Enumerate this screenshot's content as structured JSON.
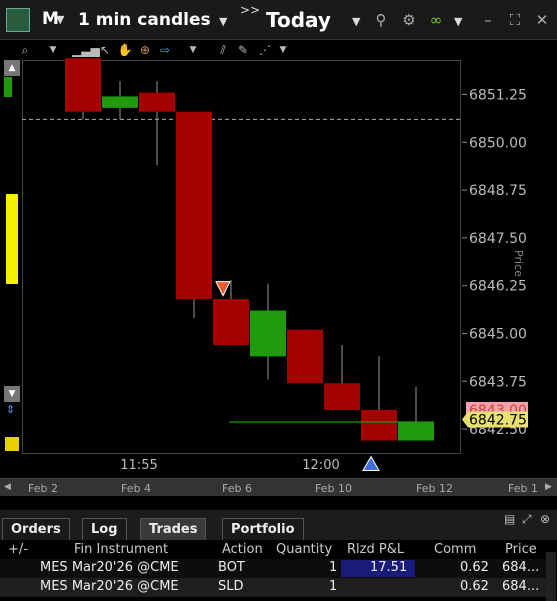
{
  "titlebar": {
    "symbol": "M",
    "period": "1 min candles",
    "range_icon": ">>",
    "range": "Today"
  },
  "chart": {
    "price_ticks": [
      "6851.25",
      "6850.00",
      "6848.75",
      "6847.50",
      "6846.25",
      "6845.00",
      "6843.75",
      "6842.50"
    ],
    "current_price": "6842.75",
    "bid_label": "6843.00",
    "axis_title": "Price",
    "time_labels": [
      "11:55",
      "12:00"
    ],
    "colors": {
      "up": "#1f9a0c",
      "down": "#a50000",
      "up_marker": "#3d6fe0",
      "down_marker": "#e85a2a"
    }
  },
  "chart_data": {
    "type": "candlestick",
    "timeframe": "1 min",
    "ylim": [
      6841.9,
      6852.1
    ],
    "ylabel": "Price",
    "xlabel": "",
    "time_ticks": [
      "11:55",
      "12:00"
    ],
    "candles": [
      {
        "open": 6852.2,
        "close": 6850.8,
        "high": 6852.2,
        "low": 6850.6
      },
      {
        "open": 6850.9,
        "close": 6851.2,
        "high": 6851.6,
        "low": 6850.6
      },
      {
        "open": 6851.3,
        "close": 6850.8,
        "high": 6851.6,
        "low": 6849.4
      },
      {
        "open": 6850.8,
        "close": 6845.9,
        "high": 6850.8,
        "low": 6845.4
      },
      {
        "open": 6845.9,
        "close": 6844.7,
        "high": 6846.4,
        "low": 6844.7
      },
      {
        "open": 6844.4,
        "close": 6845.6,
        "high": 6846.3,
        "low": 6843.8
      },
      {
        "open": 6845.1,
        "close": 6843.7,
        "high": 6845.1,
        "low": 6843.7
      },
      {
        "open": 6843.7,
        "close": 6843.0,
        "high": 6844.7,
        "low": 6843.0
      },
      {
        "open": 6843.0,
        "close": 6842.2,
        "high": 6844.4,
        "low": 6842.2
      },
      {
        "open": 6842.2,
        "close": 6842.7,
        "high": 6843.6,
        "low": 6842.2
      }
    ],
    "reference_line": 6850.6,
    "markers": [
      {
        "type": "sell",
        "candle": 4,
        "price": 6846.2
      },
      {
        "type": "buy",
        "candle": 8,
        "price": 6841.6
      }
    ]
  },
  "navigator": {
    "labels": [
      "Feb 2",
      "Feb 4",
      "Feb 6",
      "Feb 10",
      "Feb 12",
      "Feb 1"
    ]
  },
  "panel": {
    "tabs": [
      "Orders",
      "Log",
      "Trades",
      "Portfolio"
    ],
    "active_tab": "Trades",
    "columns": [
      "+/-",
      "Fin Instrument",
      "Action",
      "Quantity",
      "Rlzd P&L",
      "Comm",
      "Price"
    ],
    "rows": [
      {
        "instrument": "MES Mar20'26 @CME",
        "action": "BOT",
        "quantity": "1",
        "pnl": "17.51",
        "comm": "0.62",
        "price": "684..."
      },
      {
        "instrument": "MES Mar20'26 @CME",
        "action": "SLD",
        "quantity": "1",
        "pnl": "",
        "comm": "0.62",
        "price": "684..."
      }
    ]
  }
}
